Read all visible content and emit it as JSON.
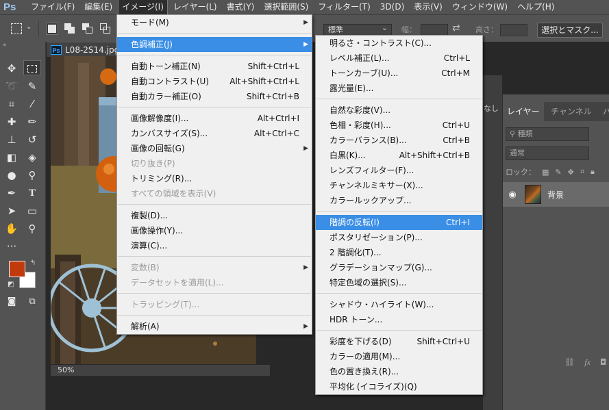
{
  "app": {
    "logo": "Ps",
    "menubar": [
      {
        "label": "ファイル(F)",
        "active": false
      },
      {
        "label": "編集(E)",
        "active": false
      },
      {
        "label": "イメージ(I)",
        "active": true
      },
      {
        "label": "レイヤー(L)",
        "active": false
      },
      {
        "label": "書式(Y)",
        "active": false
      },
      {
        "label": "選択範囲(S)",
        "active": false
      },
      {
        "label": "フィルター(T)",
        "active": false
      },
      {
        "label": "3D(D)",
        "active": false
      },
      {
        "label": "表示(V)",
        "active": false
      },
      {
        "label": "ウィンドウ(W)",
        "active": false
      },
      {
        "label": "ヘルプ(H)",
        "active": false
      }
    ]
  },
  "options_bar": {
    "style_value": "標準",
    "width_label": "幅：",
    "height_label": "高さ：",
    "select_mask_label": "選択とマスク..."
  },
  "document": {
    "tab_icon": "Ps",
    "filename": "L08-2S14.jpg",
    "zoom": "50%"
  },
  "colors": {
    "foreground": "#c13a0c",
    "background": "#ffffff",
    "menu_highlight": "#3a8ee6"
  },
  "image_menu": {
    "groups": [
      [
        {
          "label": "モード(M)",
          "shortcut": "",
          "submenu": true,
          "disabled": false,
          "highlight": false
        }
      ],
      [
        {
          "label": "色調補正(J)",
          "shortcut": "",
          "submenu": true,
          "disabled": false,
          "highlight": true
        }
      ],
      [
        {
          "label": "自動トーン補正(N)",
          "shortcut": "Shift+Ctrl+L",
          "submenu": false,
          "disabled": false,
          "highlight": false
        },
        {
          "label": "自動コントラスト(U)",
          "shortcut": "Alt+Shift+Ctrl+L",
          "submenu": false,
          "disabled": false,
          "highlight": false
        },
        {
          "label": "自動カラー補正(O)",
          "shortcut": "Shift+Ctrl+B",
          "submenu": false,
          "disabled": false,
          "highlight": false
        }
      ],
      [
        {
          "label": "画像解像度(I)...",
          "shortcut": "Alt+Ctrl+I",
          "submenu": false,
          "disabled": false,
          "highlight": false
        },
        {
          "label": "カンバスサイズ(S)...",
          "shortcut": "Alt+Ctrl+C",
          "submenu": false,
          "disabled": false,
          "highlight": false
        },
        {
          "label": "画像の回転(G)",
          "shortcut": "",
          "submenu": true,
          "disabled": false,
          "highlight": false
        },
        {
          "label": "切り抜き(P)",
          "shortcut": "",
          "submenu": false,
          "disabled": true,
          "highlight": false
        },
        {
          "label": "トリミング(R)...",
          "shortcut": "",
          "submenu": false,
          "disabled": false,
          "highlight": false
        },
        {
          "label": "すべての領域を表示(V)",
          "shortcut": "",
          "submenu": false,
          "disabled": true,
          "highlight": false
        }
      ],
      [
        {
          "label": "複製(D)...",
          "shortcut": "",
          "submenu": false,
          "disabled": false,
          "highlight": false
        },
        {
          "label": "画像操作(Y)...",
          "shortcut": "",
          "submenu": false,
          "disabled": false,
          "highlight": false
        },
        {
          "label": "演算(C)...",
          "shortcut": "",
          "submenu": false,
          "disabled": false,
          "highlight": false
        }
      ],
      [
        {
          "label": "変数(B)",
          "shortcut": "",
          "submenu": true,
          "disabled": true,
          "highlight": false
        },
        {
          "label": "データセットを適用(L)...",
          "shortcut": "",
          "submenu": false,
          "disabled": true,
          "highlight": false
        }
      ],
      [
        {
          "label": "トラッピング(T)...",
          "shortcut": "",
          "submenu": false,
          "disabled": true,
          "highlight": false
        }
      ],
      [
        {
          "label": "解析(A)",
          "shortcut": "",
          "submenu": true,
          "disabled": false,
          "highlight": false
        }
      ]
    ]
  },
  "adjustments_menu": {
    "groups": [
      [
        {
          "label": "明るさ・コントラスト(C)...",
          "shortcut": "",
          "highlight": false
        },
        {
          "label": "レベル補正(L)...",
          "shortcut": "Ctrl+L",
          "highlight": false
        },
        {
          "label": "トーンカーブ(U)...",
          "shortcut": "Ctrl+M",
          "highlight": false
        },
        {
          "label": "露光量(E)...",
          "shortcut": "",
          "highlight": false
        }
      ],
      [
        {
          "label": "自然な彩度(V)...",
          "shortcut": "",
          "highlight": false
        },
        {
          "label": "色相・彩度(H)...",
          "shortcut": "Ctrl+U",
          "highlight": false
        },
        {
          "label": "カラーバランス(B)...",
          "shortcut": "Ctrl+B",
          "highlight": false
        },
        {
          "label": "白黒(K)...",
          "shortcut": "Alt+Shift+Ctrl+B",
          "highlight": false
        },
        {
          "label": "レンズフィルター(F)...",
          "shortcut": "",
          "highlight": false
        },
        {
          "label": "チャンネルミキサー(X)...",
          "shortcut": "",
          "highlight": false
        },
        {
          "label": "カラールックアップ...",
          "shortcut": "",
          "highlight": false
        }
      ],
      [
        {
          "label": "階調の反転(I)",
          "shortcut": "Ctrl+I",
          "highlight": true
        },
        {
          "label": "ポスタリゼーション(P)...",
          "shortcut": "",
          "highlight": false
        },
        {
          "label": "2 階調化(T)...",
          "shortcut": "",
          "highlight": false
        },
        {
          "label": "グラデーションマップ(G)...",
          "shortcut": "",
          "highlight": false
        },
        {
          "label": "特定色域の選択(S)...",
          "shortcut": "",
          "highlight": false
        }
      ],
      [
        {
          "label": "シャドウ・ハイライト(W)...",
          "shortcut": "",
          "highlight": false
        },
        {
          "label": "HDR トーン...",
          "shortcut": "",
          "highlight": false
        }
      ],
      [
        {
          "label": "彩度を下げる(D)",
          "shortcut": "Shift+Ctrl+U",
          "highlight": false
        },
        {
          "label": "カラーの適用(M)...",
          "shortcut": "",
          "highlight": false
        },
        {
          "label": "色の置き換え(R)...",
          "shortcut": "",
          "highlight": false
        },
        {
          "label": "平均化 (イコライズ)(Q)",
          "shortcut": "",
          "highlight": false
        }
      ]
    ]
  },
  "layers_panel": {
    "tabs": [
      "レイヤー",
      "チャンネル",
      "パ"
    ],
    "active_tab": 0,
    "filter_label": "種類",
    "blend_mode": "通常",
    "lock_label": "ロック：",
    "layer_name": "背景",
    "side_label": "なし"
  }
}
